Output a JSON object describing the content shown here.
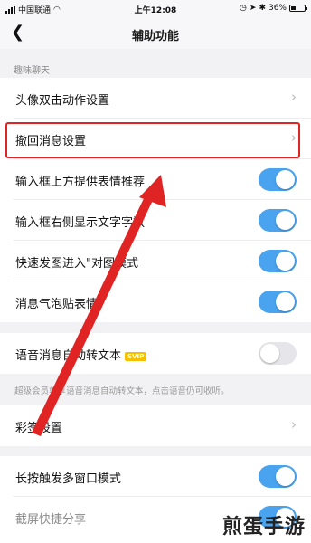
{
  "status_bar": {
    "carrier": "中国联通",
    "time": "上午12:08",
    "battery": "36%"
  },
  "nav": {
    "back_icon": "chevron-left-icon",
    "title": "辅助功能"
  },
  "section_fun_chat": "趣味聊天",
  "rows": {
    "avatar_double_tap": "头像双击动作设置",
    "recall_message": "撤回消息设置",
    "emoji_suggest": "输入框上方提供表情推荐",
    "word_count": "输入框右侧显示文字字数",
    "quick_send": "快速发图进入\"对图模式",
    "bubble_sticker": "消息气泡贴表情",
    "voice_to_text": "语音消息自动转文本",
    "caiqian": "彩签设置",
    "multi_window": "长按触发多窗口模式",
    "screenshot_share": "截屏快捷分享"
  },
  "svip_badge": "SVIP",
  "footnote": "超级会员尊享语音消息自动转文本，点击语音仍可收听。",
  "toggles": {
    "emoji_suggest": true,
    "word_count": true,
    "quick_send": true,
    "bubble_sticker": true,
    "voice_to_text": false,
    "multi_window": true,
    "screenshot_share": true
  },
  "watermark": "煎蛋手游",
  "colors": {
    "toggle_on": "#4aa3ee",
    "highlight": "#e02424",
    "arrow": "#e02424"
  }
}
